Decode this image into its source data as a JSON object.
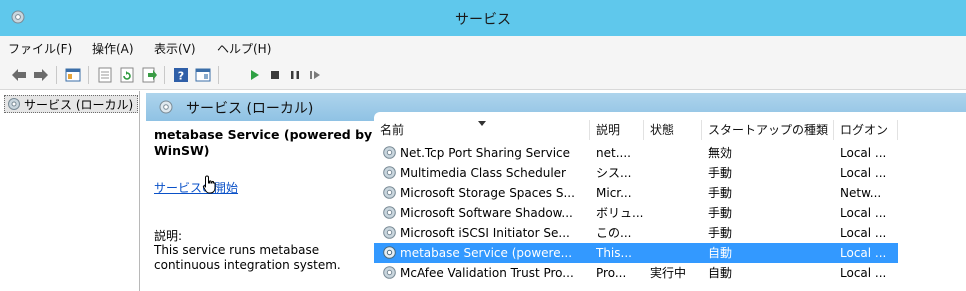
{
  "window": {
    "title": "サービス"
  },
  "menu": {
    "file": "ファイル(F)",
    "action": "操作(A)",
    "view": "表示(V)",
    "help": "ヘルプ(H)"
  },
  "toolbar": {
    "icons": [
      "back-icon",
      "forward-icon",
      "show-hide-tree-icon",
      "properties-icon",
      "refresh-icon",
      "export-list-icon",
      "help-icon",
      "show-action-pane-icon",
      "start-service-icon",
      "stop-service-icon",
      "pause-service-icon",
      "resume-service-icon"
    ]
  },
  "tree": {
    "item": "サービス (ローカル)"
  },
  "header": {
    "title": "サービス (ローカル)"
  },
  "details": {
    "title": "metabase Service (powered by WinSW)",
    "start_link": "サービスの開始",
    "description_label": "説明:",
    "description": "This service runs metabase continuous integration system."
  },
  "columns": {
    "name": "名前",
    "description": "説明",
    "status": "状態",
    "startup_type": "スタートアップの種類",
    "logon": "ログオン"
  },
  "services": [
    {
      "name": "Net.Tcp Port Sharing Service",
      "description": "net....",
      "status": "",
      "startup": "無効",
      "logon": "Local ..."
    },
    {
      "name": "Multimedia Class Scheduler",
      "description": "シス...",
      "status": "",
      "startup": "手動",
      "logon": "Local ..."
    },
    {
      "name": "Microsoft Storage Spaces S...",
      "description": "Micr...",
      "status": "",
      "startup": "手動",
      "logon": "Netw..."
    },
    {
      "name": "Microsoft Software Shadow...",
      "description": "ボリュ...",
      "status": "",
      "startup": "手動",
      "logon": "Local ..."
    },
    {
      "name": "Microsoft iSCSI Initiator Se...",
      "description": "この...",
      "status": "",
      "startup": "手動",
      "logon": "Local ..."
    },
    {
      "name": "metabase Service (powere...",
      "description": "This...",
      "status": "",
      "startup": "自動",
      "logon": "Local ...",
      "selected": true
    },
    {
      "name": "McAfee Validation Trust Pro...",
      "description": "Pro...",
      "status": "実行中",
      "startup": "自動",
      "logon": "Local ..."
    }
  ],
  "colors": {
    "titlebar": "#5fc8ec",
    "selection": "#3399ff",
    "link": "#0a51c8",
    "header": "#99c9e8"
  }
}
